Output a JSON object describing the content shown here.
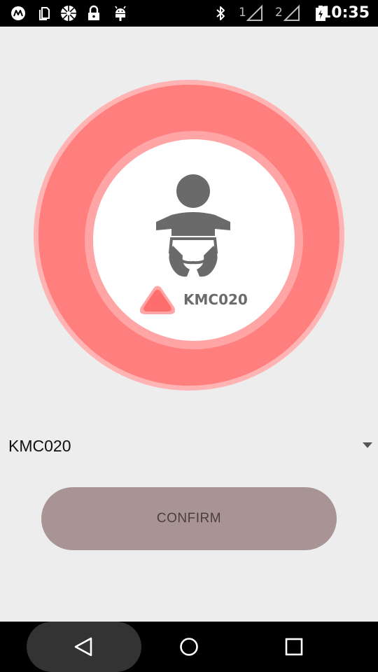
{
  "status_bar": {
    "time": "10:35",
    "sim1_label": "1",
    "sim2_label": "2",
    "notification_icons": [
      "motorola-icon",
      "sim-card-icon",
      "app-icon",
      "lock-icon",
      "android-icon"
    ],
    "system_icons": [
      "bluetooth-icon",
      "signal-icon",
      "signal-icon",
      "battery-icon"
    ]
  },
  "device_ring": {
    "device_name": "KMC020",
    "icon": "baby-icon",
    "signal_icon": "signal-triangle-icon",
    "colors": {
      "ring": "#ff7f7f",
      "halo": "#ffb3b3",
      "center": "#ffffff"
    }
  },
  "device_selector": {
    "selected": "KMC020",
    "icon": "dropdown-arrow-icon"
  },
  "confirm_button": {
    "label": "CONFIRM",
    "color": "#a89494"
  },
  "nav_bar": {
    "icons": [
      "back-icon",
      "home-icon",
      "recents-icon"
    ]
  }
}
